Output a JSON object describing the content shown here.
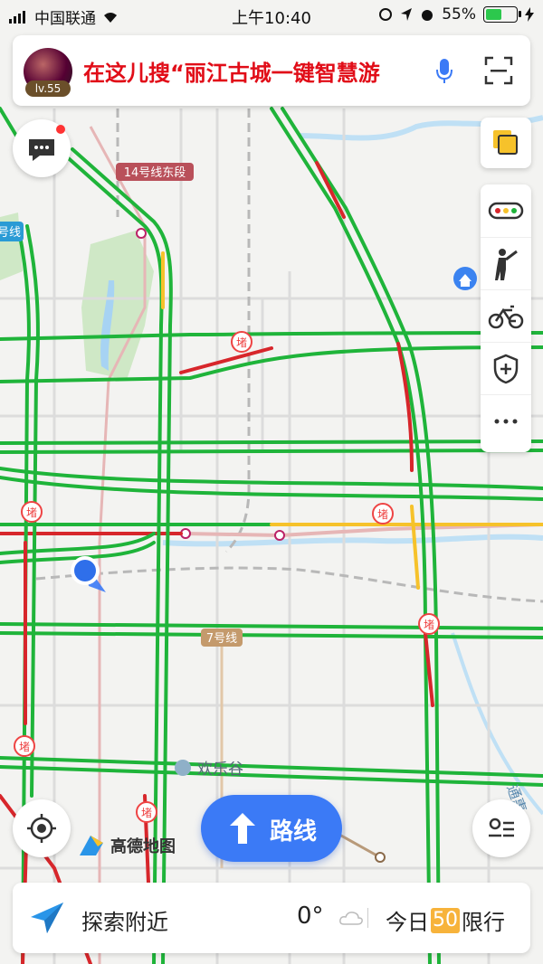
{
  "status_bar": {
    "carrier": "中国联通",
    "time": "上午10:40",
    "battery": "55%",
    "battery_level": 0.55
  },
  "search": {
    "user_level": "lv.55",
    "query_text": "在这儿搜“丽江古城一键智慧游",
    "icons": [
      "avatar",
      "microphone-icon",
      "scan-icon"
    ]
  },
  "map": {
    "labels": {
      "line14": "14号线东段",
      "line7": "7号线",
      "line_left": "号线",
      "happy_valley": "欢乐谷",
      "tongzhou": "通惠",
      "jam": "堵"
    },
    "road_colors": {
      "smooth": "#1fb43a",
      "slow": "#f6c22b",
      "congested": "#d7262b",
      "severe": "#8a1414"
    }
  },
  "tools": [
    "layers-icon",
    "traffic-icon",
    "tour-guide-icon",
    "bike-icon",
    "safety-shield-icon",
    "more-icon"
  ],
  "buttons": {
    "route": "路线"
  },
  "logo": {
    "text": "高德地图"
  },
  "bottom": {
    "explore": "探索附近",
    "temperature": "0°",
    "today": "今日",
    "limit_number": "50",
    "limit_text": "限行"
  }
}
